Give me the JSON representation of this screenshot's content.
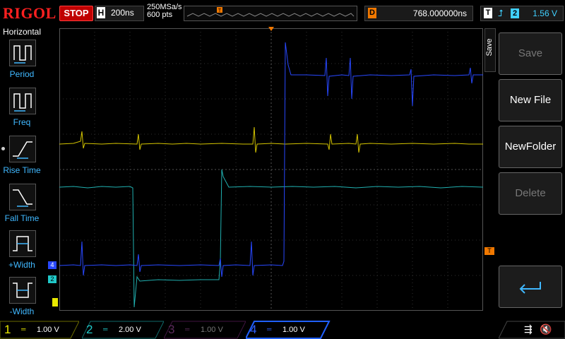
{
  "brand": "RIGOL",
  "run_state": "STOP",
  "timebase": {
    "key": "H",
    "value": "200ns"
  },
  "sample_rate": "250MSa/s",
  "memory_depth": "600 pts",
  "delay": {
    "key": "D",
    "value": "768.000000ns"
  },
  "trigger": {
    "key": "T",
    "source": "2",
    "level": "1.56 V"
  },
  "left_panel": {
    "title": "Horizontal",
    "items": [
      {
        "label": "Period"
      },
      {
        "label": "Freq"
      },
      {
        "label": "Rise Time"
      },
      {
        "label": "Fall Time"
      },
      {
        "label": "+Width"
      },
      {
        "label": "-Width"
      }
    ]
  },
  "right_menu": {
    "tab": "Save",
    "items": [
      {
        "label": "Save",
        "enabled": false
      },
      {
        "label": "New File",
        "enabled": true
      },
      {
        "label": "NewFolder",
        "enabled": true
      },
      {
        "label": "Delete",
        "enabled": false
      }
    ]
  },
  "channels": [
    {
      "num": "1",
      "scale": "1.00 V",
      "color": "#e8e800"
    },
    {
      "num": "2",
      "scale": "2.00 V",
      "color": "#20c8c8"
    },
    {
      "num": "3",
      "scale": "1.00 V",
      "color": "#b040b0"
    },
    {
      "num": "4",
      "scale": "1.00 V",
      "color": "#3050ff"
    }
  ],
  "markers": {
    "ch4": "4",
    "ch2": "2",
    "trigger": "T"
  }
}
